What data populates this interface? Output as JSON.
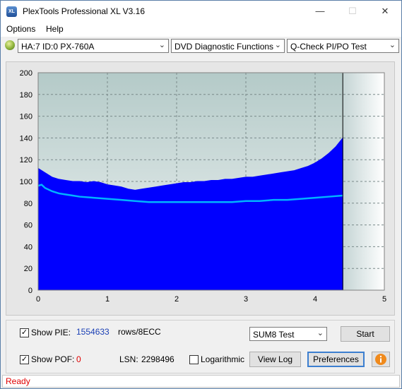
{
  "window": {
    "title": "PlexTools Professional XL V3.16",
    "app_icon_text": "XL"
  },
  "menu": [
    {
      "label": "Options"
    },
    {
      "label": "Help"
    }
  ],
  "toolbar": {
    "device": "HA:7 ID:0  PX-760A",
    "function": "DVD Diagnostic Functions",
    "test": "Q-Check PI/PO Test"
  },
  "chart_data": {
    "type": "area",
    "x_ticks": [
      "0",
      "1",
      "2",
      "3",
      "4",
      "5"
    ],
    "y_ticks": [
      "0",
      "20",
      "40",
      "60",
      "80",
      "100",
      "120",
      "140",
      "160",
      "180",
      "200"
    ],
    "xlim": [
      0,
      5
    ],
    "ylim": [
      0,
      200
    ],
    "grid": true,
    "scan_end_x": 4.4,
    "series": [
      {
        "color": "#0000ff",
        "x": [
          0,
          0.1,
          0.2,
          0.3,
          0.4,
          0.5,
          0.6,
          0.7,
          0.8,
          0.9,
          1.0,
          1.1,
          1.2,
          1.3,
          1.4,
          1.5,
          1.6,
          1.7,
          1.8,
          1.9,
          2.0,
          2.1,
          2.2,
          2.3,
          2.4,
          2.5,
          2.6,
          2.7,
          2.8,
          2.9,
          3.0,
          3.1,
          3.2,
          3.3,
          3.4,
          3.5,
          3.6,
          3.7,
          3.8,
          3.9,
          4.0,
          4.1,
          4.2,
          4.3,
          4.4
        ],
        "values": [
          112,
          108,
          104,
          102,
          101,
          100,
          100,
          99,
          100,
          99,
          97,
          96,
          95,
          93,
          92,
          93,
          94,
          95,
          96,
          97,
          98,
          99,
          99,
          100,
          100,
          101,
          101,
          102,
          102,
          103,
          104,
          104,
          105,
          106,
          107,
          108,
          109,
          110,
          112,
          114,
          117,
          121,
          126,
          132,
          140
        ]
      },
      {
        "color": "#00b4ff",
        "x": [
          0,
          0.05,
          0.1,
          0.2,
          0.3,
          0.4,
          0.5,
          0.6,
          0.8,
          1.0,
          1.2,
          1.4,
          1.6,
          1.8,
          2.0,
          2.2,
          2.4,
          2.6,
          2.8,
          3.0,
          3.2,
          3.4,
          3.6,
          3.8,
          4.0,
          4.2,
          4.4
        ],
        "values": [
          96,
          97,
          94,
          91,
          89,
          88,
          87,
          86,
          85,
          84,
          83,
          82,
          81,
          81,
          81,
          81,
          81,
          81,
          81,
          82,
          82,
          83,
          83,
          84,
          85,
          86,
          87
        ]
      }
    ]
  },
  "controls": {
    "show_pie_label": "Show PIE:",
    "show_pie_checked": true,
    "pie_value": "1554633",
    "pie_unit": "rows/8ECC",
    "show_pof_label": "Show POF:",
    "show_pof_checked": true,
    "pof_value": "0",
    "lsn_label": "LSN:",
    "lsn_value": "2298496",
    "logarithmic_label": "Logarithmic",
    "logarithmic_checked": false,
    "sum_select": "SUM8 Test",
    "start_label": "Start",
    "view_log_label": "View Log",
    "preferences_label": "Preferences"
  },
  "status": {
    "text": "Ready"
  },
  "colors": {
    "pie": "#0000ff",
    "pif": "#00b4ff",
    "pof_value": "#e00000",
    "pie_value": "#1a3fb5",
    "status": "#e00000"
  }
}
